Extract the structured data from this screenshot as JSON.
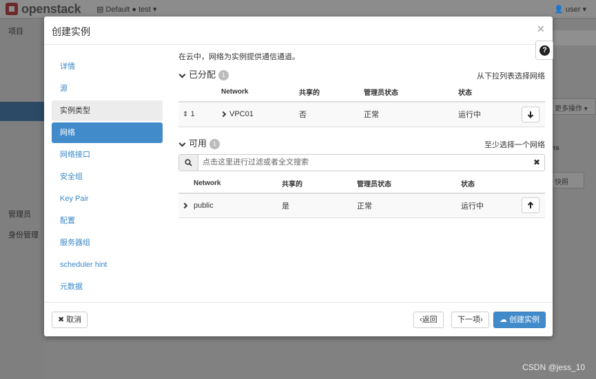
{
  "topbar": {
    "brand": "openstack",
    "domain_label": "Default",
    "project_label": "test",
    "user_label": "user"
  },
  "background": {
    "sidebar_project": "项目",
    "sidebar_admin": "管理员",
    "sidebar_identity": "身份管理",
    "more_actions": "更多操作",
    "actions_header": "ns",
    "snapshot_btn": "快照"
  },
  "modal": {
    "title": "创建实例",
    "nav": [
      {
        "label": "详情"
      },
      {
        "label": "源"
      },
      {
        "label": "实例类型"
      },
      {
        "label": "网络"
      },
      {
        "label": "网络接口"
      },
      {
        "label": "安全组"
      },
      {
        "label": "Key Pair"
      },
      {
        "label": "配置"
      },
      {
        "label": "服务器组"
      },
      {
        "label": "scheduler hint"
      },
      {
        "label": "元数据"
      }
    ],
    "intro": "在云中，网络为实例提供通信通道。",
    "allocated": {
      "title": "已分配",
      "count": "1",
      "hint": "从下拉列表选择网络",
      "headers": [
        "Network",
        "共享的",
        "管理员状态",
        "状态"
      ],
      "rows": [
        {
          "index": "1",
          "network": "VPC01",
          "shared": "否",
          "admin_state": "正常",
          "status": "运行中"
        }
      ]
    },
    "available": {
      "title": "可用",
      "count": "1",
      "hint": "至少选择一个网络",
      "search_placeholder": "点击这里进行过滤或者全文搜索",
      "headers": [
        "Network",
        "共享的",
        "管理员状态",
        "状态"
      ],
      "rows": [
        {
          "network": "public",
          "shared": "是",
          "admin_state": "正常",
          "status": "运行中"
        }
      ]
    },
    "footer": {
      "cancel": "取消",
      "back": "‹返回",
      "next": "下一项›",
      "launch": "创建实例"
    }
  },
  "watermark": "CSDN @jess_10"
}
